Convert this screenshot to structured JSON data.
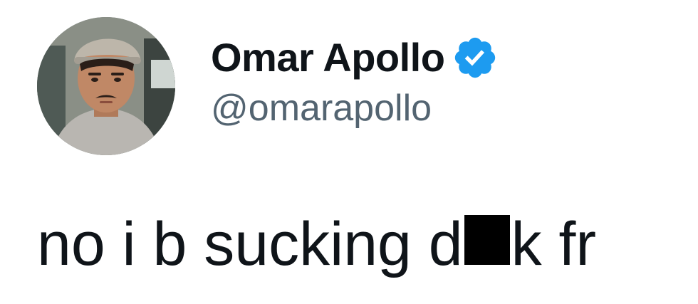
{
  "tweet": {
    "author": {
      "display_name": "Omar Apollo",
      "handle": "@omarapollo",
      "verified": true,
      "avatar_icon": "avatar-photo"
    },
    "text_before_censor": "no i b sucking d",
    "text_after_censor": "k fr"
  },
  "colors": {
    "text_primary": "#0f1419",
    "text_secondary": "#536471",
    "verified_blue": "#1d9bf0",
    "censor": "#000000",
    "background": "#ffffff"
  }
}
